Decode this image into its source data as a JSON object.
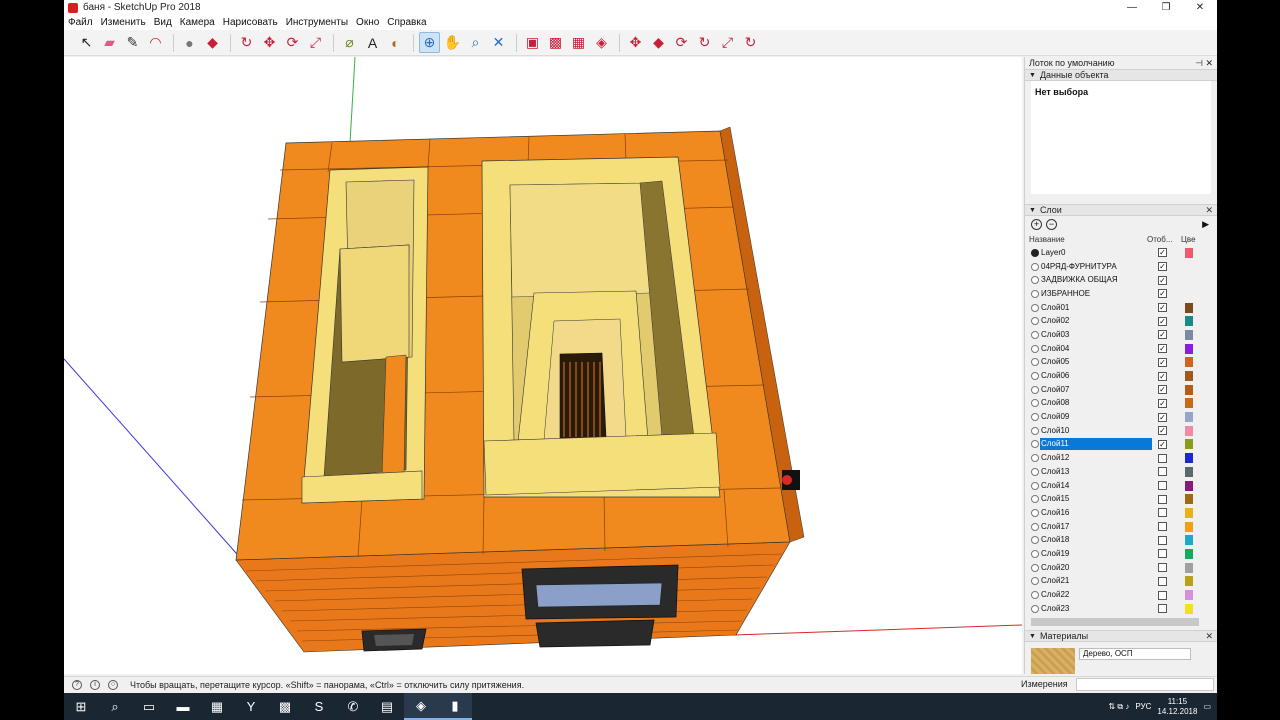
{
  "window": {
    "title": "баня - SketchUp Pro 2018",
    "controls": [
      "—",
      "❐",
      "✕"
    ]
  },
  "menu": [
    "Файл",
    "Изменить",
    "Вид",
    "Камера",
    "Нарисовать",
    "Инструменты",
    "Окно",
    "Справка"
  ],
  "toolbar": {
    "tools": [
      {
        "name": "select-tool-icon",
        "glyph": "↖"
      },
      {
        "name": "eraser-tool-icon",
        "glyph": "▰"
      },
      {
        "name": "pencil-tool-icon",
        "glyph": "✎"
      },
      {
        "name": "arc-tool-icon",
        "glyph": "◠"
      },
      {
        "name": "shape-tool-icon",
        "glyph": "●"
      },
      {
        "name": "pushpull-tool-icon",
        "glyph": "◆"
      },
      {
        "name": "followme-tool-icon",
        "glyph": "↻"
      },
      {
        "name": "move-tool-icon",
        "glyph": "✥"
      },
      {
        "name": "rotate-tool-icon",
        "glyph": "⟳"
      },
      {
        "name": "scale-tool-icon",
        "glyph": "⤢"
      },
      {
        "name": "tape-tool-icon",
        "glyph": "⌀"
      },
      {
        "name": "text-tool-icon",
        "glyph": "A"
      },
      {
        "name": "paint-tool-icon",
        "glyph": "◐"
      },
      {
        "name": "orbit-tool-icon",
        "glyph": "⊕"
      },
      {
        "name": "pan-tool-icon",
        "glyph": "✋"
      },
      {
        "name": "zoom-tool-icon",
        "glyph": "⌕"
      },
      {
        "name": "zoom-extents-icon",
        "glyph": "✕"
      },
      {
        "name": "warehouse-icon",
        "glyph": "▣"
      },
      {
        "name": "extension-warehouse-icon",
        "glyph": "▩"
      },
      {
        "name": "layout-icon",
        "glyph": "▦"
      },
      {
        "name": "ruby-icon",
        "glyph": "◈"
      },
      {
        "name": "move-tool-2-icon",
        "glyph": "✥"
      },
      {
        "name": "pushpull-tool-2-icon",
        "glyph": "◆"
      },
      {
        "name": "rotate-tool-2-icon",
        "glyph": "⟳"
      },
      {
        "name": "followme-tool-2-icon",
        "glyph": "↻"
      },
      {
        "name": "scale-tool-2-icon",
        "glyph": "⤢"
      },
      {
        "name": "offset-tool-icon",
        "glyph": "↻"
      }
    ]
  },
  "tray": {
    "title": "Лоток по умолчанию",
    "entity_info": {
      "header": "Данные объекта",
      "selection": "Нет выбора"
    },
    "layers": {
      "header": "Слои",
      "col_name": "Название",
      "col_visible": "Отоб...",
      "col_color": "Цве",
      "items": [
        {
          "name": "Layer0",
          "visible": true,
          "color": "#f05a6e",
          "current": true
        },
        {
          "name": "04РЯД-ФУРНИТУРА",
          "visible": true,
          "color": ""
        },
        {
          "name": "ЗАДВИЖКА ОБЩАЯ",
          "visible": true,
          "color": ""
        },
        {
          "name": "ИЗБРАННОЕ",
          "visible": true,
          "color": ""
        },
        {
          "name": "Слой01",
          "visible": true,
          "color": "#7a4a1e"
        },
        {
          "name": "Слой02",
          "visible": true,
          "color": "#1a8a86"
        },
        {
          "name": "Слой03",
          "visible": true,
          "color": "#7b8aa0"
        },
        {
          "name": "Слой04",
          "visible": true,
          "color": "#8b1fe0"
        },
        {
          "name": "Слой05",
          "visible": true,
          "color": "#d2651c"
        },
        {
          "name": "Слой06",
          "visible": true,
          "color": "#a0581c"
        },
        {
          "name": "Слой07",
          "visible": true,
          "color": "#b85a1a"
        },
        {
          "name": "Слой08",
          "visible": true,
          "color": "#c86a14"
        },
        {
          "name": "Слой09",
          "visible": true,
          "color": "#9aa4c8"
        },
        {
          "name": "Слой10",
          "visible": true,
          "color": "#f08aa8"
        },
        {
          "name": "Слой11",
          "visible": true,
          "color": "#8a9a1a",
          "selected": true
        },
        {
          "name": "Слой12",
          "visible": false,
          "color": "#1a2ad0"
        },
        {
          "name": "Слой13",
          "visible": false,
          "color": "#5a6a6a"
        },
        {
          "name": "Слой14",
          "visible": false,
          "color": "#8a1a7a"
        },
        {
          "name": "Слой15",
          "visible": false,
          "color": "#a06a14"
        },
        {
          "name": "Слой16",
          "visible": false,
          "color": "#e8b020"
        },
        {
          "name": "Слой17",
          "visible": false,
          "color": "#f0a010"
        },
        {
          "name": "Слой18",
          "visible": false,
          "color": "#20a8c8"
        },
        {
          "name": "Слой19",
          "visible": false,
          "color": "#18a860"
        },
        {
          "name": "Слой20",
          "visible": false,
          "color": "#a0a0a0"
        },
        {
          "name": "Слой21",
          "visible": false,
          "color": "#b8a018"
        },
        {
          "name": "Слой22",
          "visible": false,
          "color": "#d890d8"
        },
        {
          "name": "Слой23",
          "visible": false,
          "color": "#f0e020"
        }
      ]
    },
    "materials": {
      "header": "Материалы",
      "current": "Дерево, ОСП"
    }
  },
  "status": {
    "hint": "Чтобы вращать, перетащите курсор. «Shift» = панорама, «Ctrl» = отключить силу притяжения.",
    "measure_label": "Измерения",
    "measure_value": ""
  },
  "taskbar": {
    "apps": [
      {
        "name": "start-icon",
        "glyph": "⊞"
      },
      {
        "name": "search-icon",
        "glyph": "⌕"
      },
      {
        "name": "task-view-icon",
        "glyph": "▭"
      },
      {
        "name": "explorer-icon",
        "glyph": "▬"
      },
      {
        "name": "store-icon",
        "glyph": "▦"
      },
      {
        "name": "yandex-browser-icon",
        "glyph": "Y"
      },
      {
        "name": "archive-icon",
        "glyph": "▩"
      },
      {
        "name": "skype-icon",
        "glyph": "S"
      },
      {
        "name": "viber-icon",
        "glyph": "✆"
      },
      {
        "name": "notepad-icon",
        "glyph": "▤"
      },
      {
        "name": "sketchup-icon",
        "glyph": "◈"
      },
      {
        "name": "recorder-icon",
        "glyph": "▮"
      }
    ],
    "lang": "РУС",
    "time": "11:15",
    "date": "14.12.2018"
  },
  "colors": {
    "brick_orange": "#f08a1e",
    "fireclay_yellow": "#f5df7a",
    "selection_blue": "#0a78d7"
  }
}
